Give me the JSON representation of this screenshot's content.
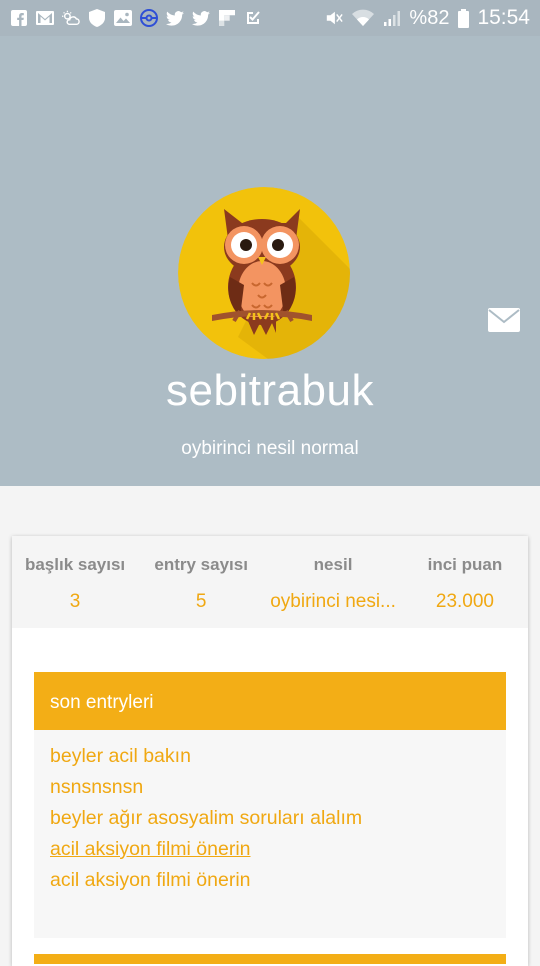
{
  "status_bar": {
    "left_icons": [
      "facebook-icon",
      "gmail-icon",
      "weather-icon",
      "shield-icon",
      "gallery-icon",
      "pokeball-icon",
      "twitter-icon",
      "twitter-icon",
      "flipboard-icon",
      "check-icon"
    ],
    "right_icons": [
      "mute-icon",
      "wifi-icon",
      "signal-icon"
    ],
    "battery": "%82",
    "time": "15:54"
  },
  "profile": {
    "username": "sebitrabuk",
    "generation": "oybirinci nesil normal",
    "avatar_icon": "owl-icon",
    "message_icon": "envelope-icon"
  },
  "stats": [
    {
      "label": "başlık sayısı",
      "value": "3"
    },
    {
      "label": "entry sayısı",
      "value": "5"
    },
    {
      "label": "nesil",
      "value": "oybirinci nesi..."
    },
    {
      "label": "inci puan",
      "value": "23.000"
    }
  ],
  "recent_entries": {
    "title": "son entryleri",
    "items": [
      {
        "text": "beyler acil bakın"
      },
      {
        "text": "nsnsnsnsn"
      },
      {
        "text": "beyler ağır asosyalim soruları alalım"
      },
      {
        "text": "acil aksiyon filmi önerin"
      },
      {
        "text": "acil aksiyon filmi önerin"
      }
    ]
  },
  "colors": {
    "accent": "#f3ae16",
    "header_bg": "#adbcc5",
    "link": "#f0a812"
  }
}
